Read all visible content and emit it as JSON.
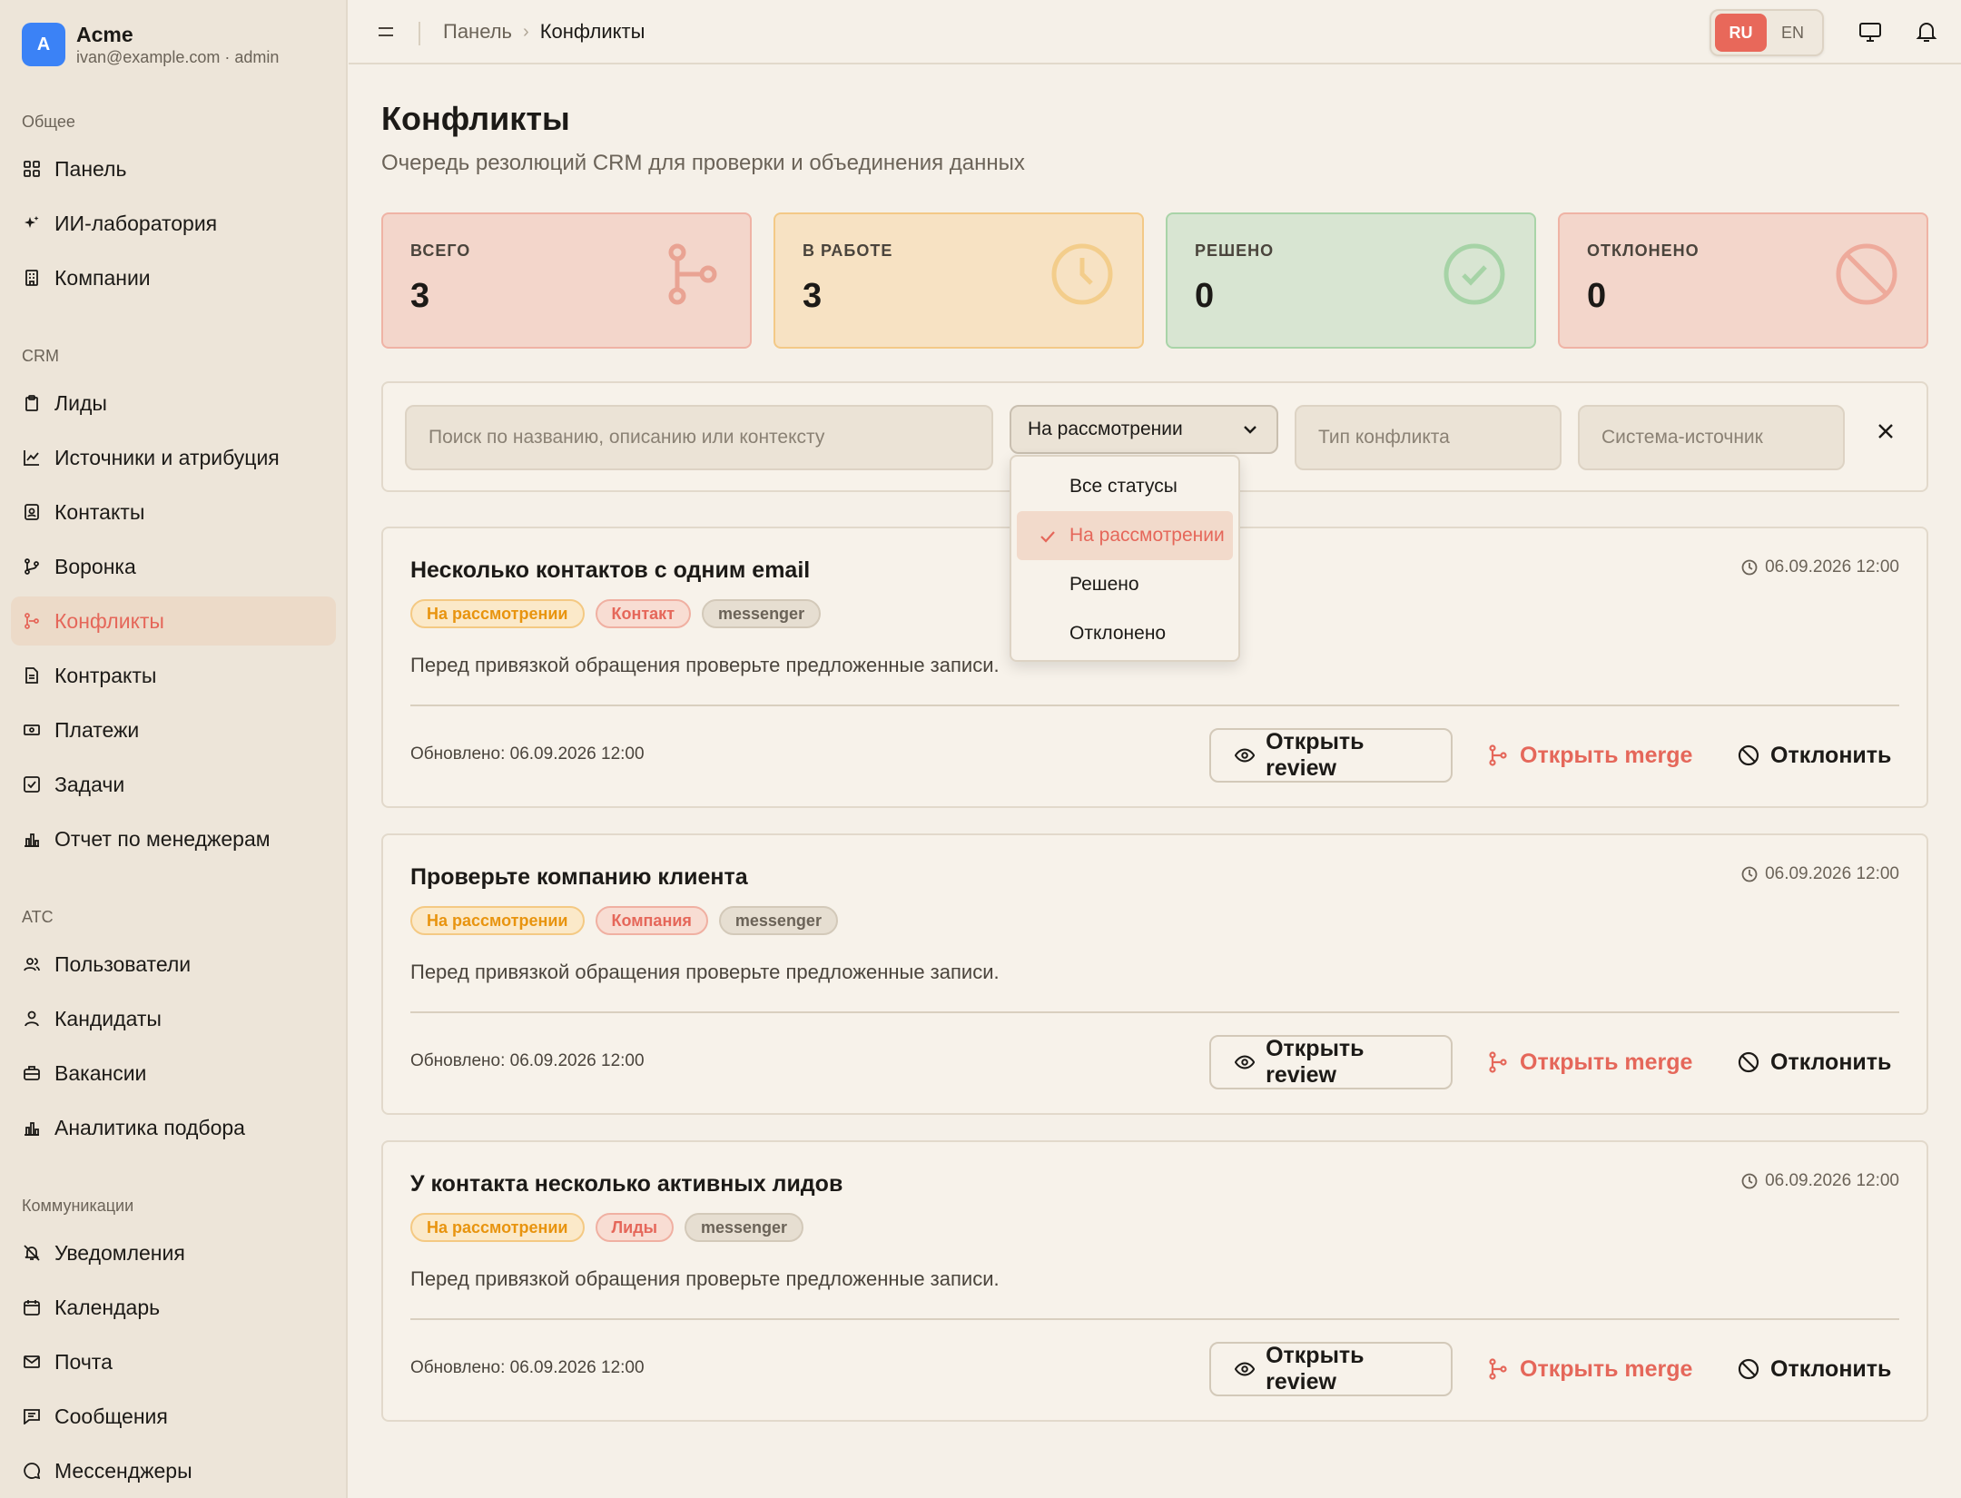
{
  "account": {
    "initial": "A",
    "name": "Acme",
    "email": "ivan@example.com · admin"
  },
  "sidebar": {
    "groups": [
      {
        "title": "Общее",
        "items": [
          "Панель",
          "ИИ-лаборатория",
          "Компании"
        ]
      },
      {
        "title": "CRM",
        "items": [
          "Лиды",
          "Источники и атрибуция",
          "Контакты",
          "Воронка",
          "Конфликты",
          "Контракты",
          "Платежи",
          "Задачи",
          "Отчет по менеджерам"
        ]
      },
      {
        "title": "ATC",
        "items": [
          "Пользователи",
          "Кандидаты",
          "Вакансии",
          "Аналитика подбора"
        ]
      },
      {
        "title": "Коммуникации",
        "items": [
          "Уведомления",
          "Календарь",
          "Почта",
          "Сообщения",
          "Мессенджеры"
        ]
      }
    ],
    "active": "Конфликты"
  },
  "breadcrumb": {
    "parent": "Панель",
    "current": "Конфликты"
  },
  "lang": {
    "ru": "RU",
    "en": "EN",
    "active": "RU"
  },
  "page": {
    "title": "Конфликты",
    "subtitle": "Очередь резолюций CRM для проверки и объединения данных"
  },
  "stats": {
    "total": {
      "label": "ВСЕГО",
      "value": "3"
    },
    "in_work": {
      "label": "В РАБОТЕ",
      "value": "3"
    },
    "resolved": {
      "label": "РЕШЕНО",
      "value": "0"
    },
    "rejected": {
      "label": "ОТКЛОНЕНО",
      "value": "0"
    }
  },
  "filters": {
    "search_placeholder": "Поиск по названию, описанию или контексту",
    "status_value": "На рассмотрении",
    "type_placeholder": "Тип конфликта",
    "source_placeholder": "Система-источник"
  },
  "status_options": [
    "Все статусы",
    "На рассмотрении",
    "Решено",
    "Отклонено"
  ],
  "cards": [
    {
      "title": "Несколько контактов с одним email",
      "date": "06.09.2026 12:00",
      "status": "На рассмотрении",
      "type": "Контакт",
      "source": "messenger",
      "desc": "Перед привязкой обращения проверьте предложенные записи.",
      "updated": "Обновлено: 06.09.2026 12:00"
    },
    {
      "title": "Проверьте компанию клиента",
      "date": "06.09.2026 12:00",
      "status": "На рассмотрении",
      "type": "Компания",
      "source": "messenger",
      "desc": "Перед привязкой обращения проверьте предложенные записи.",
      "updated": "Обновлено: 06.09.2026 12:00"
    },
    {
      "title": "У контакта несколько активных лидов",
      "date": "06.09.2026 12:00",
      "status": "На рассмотрении",
      "type": "Лиды",
      "source": "messenger",
      "desc": "Перед привязкой обращения проверьте предложенные записи.",
      "updated": "Обновлено: 06.09.2026 12:00"
    }
  ],
  "actions": {
    "review": "Открыть review",
    "merge": "Открыть merge",
    "reject": "Отклонить"
  },
  "colors": {
    "accent": "#e5675a",
    "warning": "#e8940f",
    "success": "#6fbf73"
  }
}
